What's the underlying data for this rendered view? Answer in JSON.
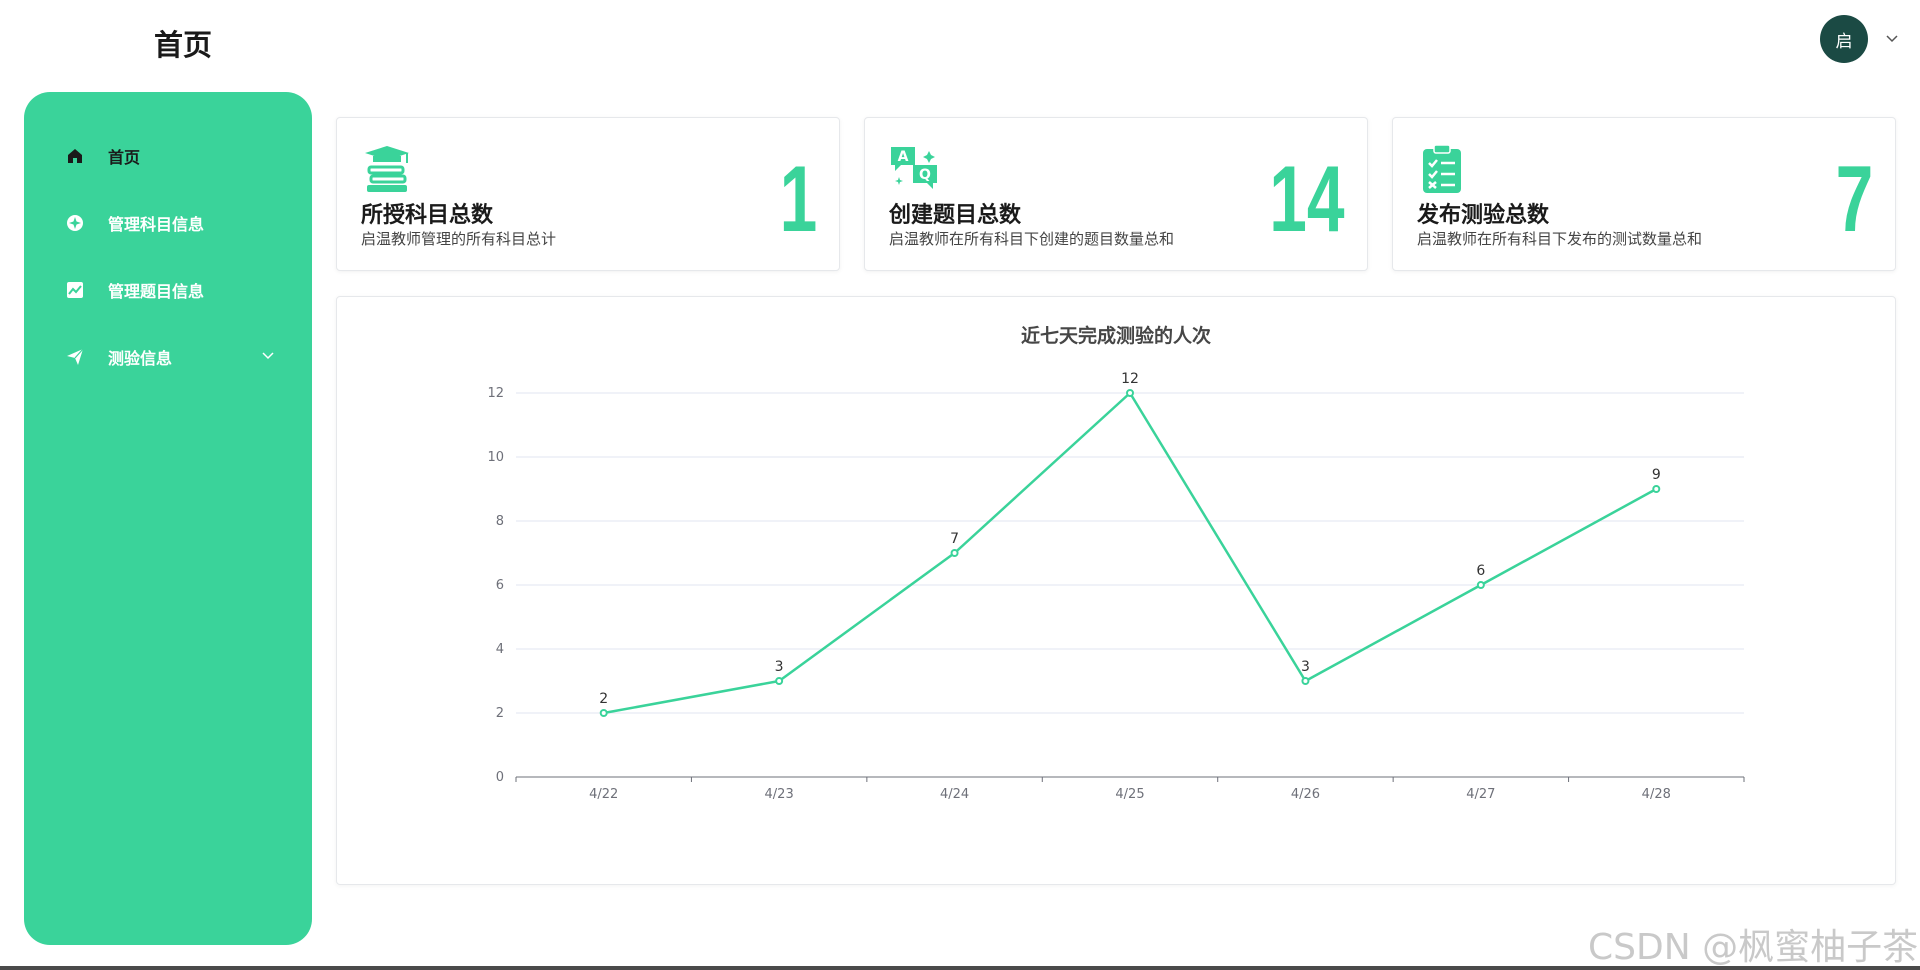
{
  "header": {
    "page_title": "首页",
    "avatar_text": "启",
    "avatar_color": "#1b4a44"
  },
  "theme": {
    "accent": "#3ad39a",
    "sidebar_text": "#ffffff"
  },
  "sidebar": {
    "items": [
      {
        "label": "首页",
        "icon": "home-icon",
        "active": true
      },
      {
        "label": "管理科目信息",
        "icon": "compass-icon",
        "active": false
      },
      {
        "label": "管理题目信息",
        "icon": "line-chart-icon",
        "active": false
      },
      {
        "label": "测验信息",
        "icon": "paper-plane-icon",
        "active": false,
        "has_submenu": true
      }
    ]
  },
  "cards": [
    {
      "icon": "graduation-books-icon",
      "title": "所授科目总数",
      "desc": "启温教师管理的所有科目总计",
      "value": "1"
    },
    {
      "icon": "qa-chat-icon",
      "title": "创建题目总数",
      "desc": "启温教师在所有科目下创建的题目数量总和",
      "value": "14"
    },
    {
      "icon": "clipboard-checklist-icon",
      "title": "发布测验总数",
      "desc": "启温教师在所有科目下发布的测试数量总和",
      "value": "7"
    }
  ],
  "chart_data": {
    "type": "line",
    "title": "近七天完成测验的人次",
    "categories": [
      "4/22",
      "4/23",
      "4/24",
      "4/25",
      "4/26",
      "4/27",
      "4/28"
    ],
    "values": [
      2,
      3,
      7,
      12,
      3,
      6,
      9
    ],
    "ylim": [
      0,
      12
    ],
    "yticks": [
      0,
      2,
      4,
      6,
      8,
      10,
      12
    ],
    "grid": true,
    "data_labels": true,
    "line_color": "#3ad39a"
  },
  "watermark": "CSDN @枫蜜柚子茶"
}
